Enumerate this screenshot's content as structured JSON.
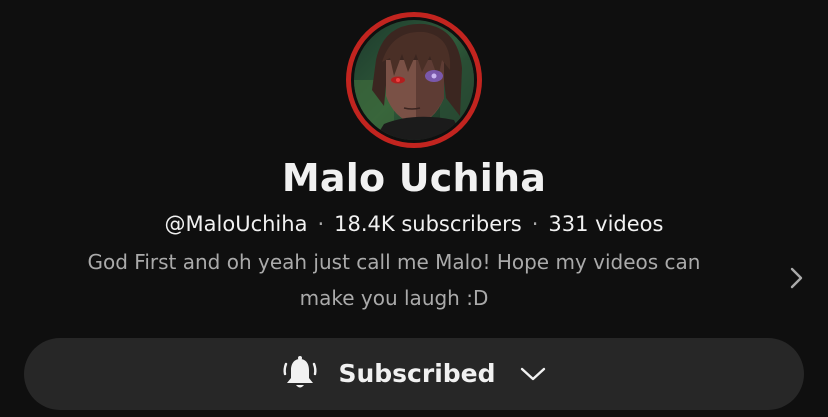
{
  "channel": {
    "avatar_icon": "channel-avatar",
    "ring_color": "#c2241f",
    "name": "Malo Uchiha",
    "handle": "@MaloUchiha",
    "separator": "·",
    "subscribers": "18.4K subscribers",
    "videos": "331 videos",
    "description_line1": "God First and oh yeah just call me Malo! Hope my videos can",
    "description_line2": "make you laugh :D",
    "description_more_icon": "chevron-right-icon"
  },
  "subscribe": {
    "label": "Subscribed",
    "bell_icon": "bell-icon",
    "dropdown_icon": "chevron-down-icon",
    "background": "#272727"
  },
  "colors": {
    "background": "#0f0f0f",
    "primary_text": "#f1f1f1",
    "secondary_text": "#aaaaaa"
  }
}
